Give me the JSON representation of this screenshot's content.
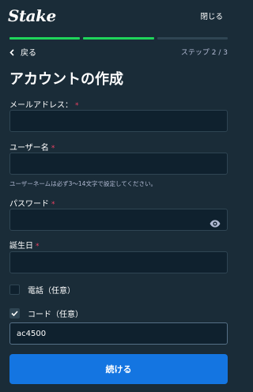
{
  "header": {
    "logo": "Stake",
    "close_label": "閉じる"
  },
  "progress": {
    "current_step": 2,
    "total_steps": 3
  },
  "nav": {
    "back_label": "戻る",
    "step_text": "ステップ 2 / 3"
  },
  "page": {
    "title": "アカウントの作成"
  },
  "form": {
    "email": {
      "label": "メールアドレス：",
      "required_mark": "*",
      "value": ""
    },
    "username": {
      "label": "ユーザー名",
      "required_mark": "*",
      "value": "",
      "hint": "ユーザーネームは必ず3～14文字で設定してください。"
    },
    "password": {
      "label": "パスワード",
      "required_mark": "*",
      "value": ""
    },
    "birthdate": {
      "label": "誕生日",
      "required_mark": "*",
      "value": ""
    },
    "phone_option": {
      "label": "電話（任意）",
      "checked": false
    },
    "code_option": {
      "label": "コード（任意）",
      "checked": true
    },
    "code": {
      "value": "ac4500"
    }
  },
  "actions": {
    "continue_label": "続ける"
  },
  "colors": {
    "background": "#1a2c38",
    "field": "#0f212e",
    "border": "#2f4553",
    "progress": "#1fd45a",
    "primary": "#1475e1",
    "required": "#ed4163"
  }
}
